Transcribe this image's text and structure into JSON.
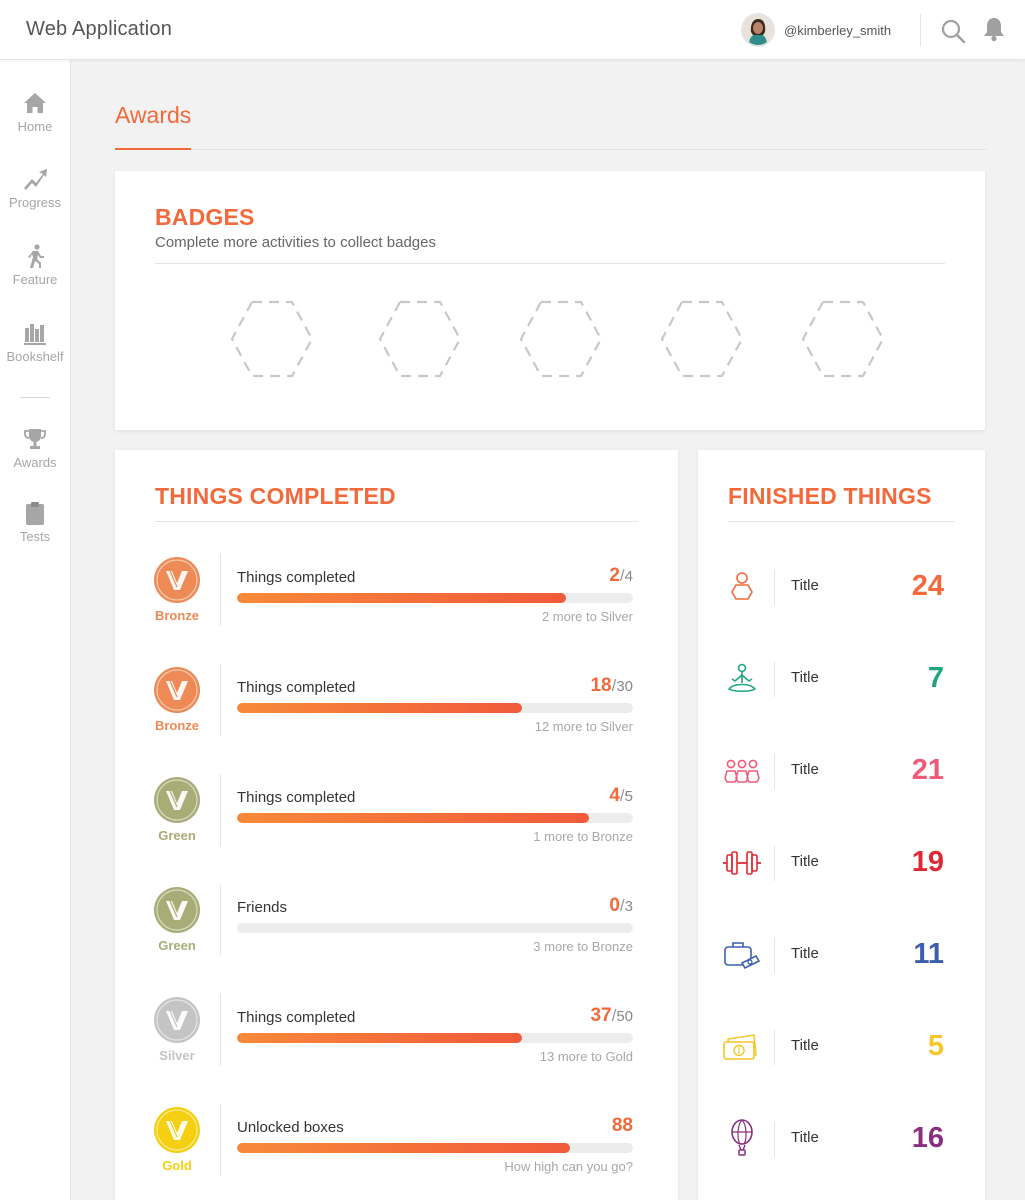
{
  "header": {
    "app_title": "Web Application",
    "username": "@kimberley_smith",
    "avatar_icon": "user-avatar",
    "search_icon": "search-icon",
    "notifications_icon": "bell-icon"
  },
  "sidebar": {
    "items": [
      {
        "label": "Home",
        "icon": "home-icon"
      },
      {
        "label": "Progress",
        "icon": "trend-up-icon"
      },
      {
        "label": "Feature",
        "icon": "running-icon"
      },
      {
        "label": "Bookshelf",
        "icon": "bookshelf-icon"
      },
      {
        "label": "Awards",
        "icon": "trophy-icon"
      },
      {
        "label": "Tests",
        "icon": "clipboard-icon"
      }
    ]
  },
  "page": {
    "title": "Awards",
    "accent_color": "#f26a3c"
  },
  "badges": {
    "heading": "BADGES",
    "subtitle": "Complete more activities to collect badges",
    "empty_slots": 5
  },
  "things_completed": {
    "heading": "THINGS COMPLETED",
    "rows": [
      {
        "medal": "Bronze",
        "title": "Things completed",
        "count": "2",
        "total": "4",
        "progress": 0.83,
        "hint": "2 more to Silver"
      },
      {
        "medal": "Bronze",
        "title": "Things completed",
        "count": "18",
        "total": "30",
        "progress": 0.72,
        "hint": "12 more to Silver"
      },
      {
        "medal": "Green",
        "title": "Things completed",
        "count": "4",
        "total": "5",
        "progress": 0.89,
        "hint": "1 more to Bronze"
      },
      {
        "medal": "Green",
        "title": "Friends",
        "count": "0",
        "total": "3",
        "progress": 0.0,
        "hint": "3 more to Bronze"
      },
      {
        "medal": "Silver",
        "title": "Things completed",
        "count": "37",
        "total": "50",
        "progress": 0.72,
        "hint": "13 more to Gold"
      },
      {
        "medal": "Gold",
        "title": "Unlocked boxes",
        "count": "88",
        "total": "",
        "progress": 0.84,
        "hint": "How high can you go?"
      }
    ]
  },
  "medal_colors": {
    "Bronze": "#ee8a55",
    "Green": "#a8ad78",
    "Silver": "#c4c4c4",
    "Gold": "#f5cf12"
  },
  "finished_things": {
    "heading": "FINISHED THINGS",
    "rows": [
      {
        "icon": "person-icon",
        "title": "Title",
        "value": "24",
        "color": "#f26a3c"
      },
      {
        "icon": "meditation-icon",
        "title": "Title",
        "value": "7",
        "color": "#1fa57f"
      },
      {
        "icon": "group-icon",
        "title": "Title",
        "value": "21",
        "color": "#ef5a78"
      },
      {
        "icon": "dumbbell-icon",
        "title": "Title",
        "value": "19",
        "color": "#e02835"
      },
      {
        "icon": "briefcase-icon",
        "title": "Title",
        "value": "11",
        "color": "#3c5fad"
      },
      {
        "icon": "money-icon",
        "title": "Title",
        "value": "5",
        "color": "#f6c62a"
      },
      {
        "icon": "balloon-icon",
        "title": "Title",
        "value": "16",
        "color": "#8a2f80"
      }
    ]
  }
}
